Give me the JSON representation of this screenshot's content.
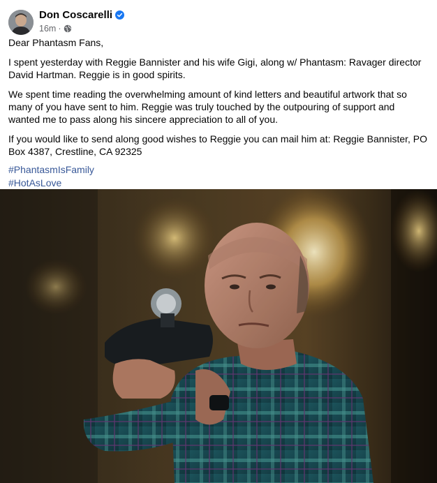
{
  "post": {
    "author": "Don Coscarelli",
    "timestamp": "16m",
    "greeting": "Dear Phantasm Fans,",
    "paragraph1": "I spent yesterday with Reggie Bannister and his wife Gigi, along w/ Phantasm: Ravager director David Hartman. Reggie is in good spirits.",
    "paragraph2": "We spent time reading the overwhelming amount of kind letters and beautiful artwork that so many of you have sent to him. Reggie was truly touched by the outpouring of support and wanted me to pass along his sincere appreciation to all of you.",
    "paragraph3": "If you would like to send along good wishes to Reggie you can mail him at: Reggie Bannister, PO Box 4387, Crestline, CA 92325",
    "hashtags": [
      "#PhantasmIsFamily",
      "#HotAsLove"
    ],
    "separator": "·"
  },
  "icons": {
    "verified": "verified-badge-icon",
    "privacy": "globe-icon"
  },
  "colors": {
    "verified_blue": "#1877f2",
    "hashtag_link": "#385898",
    "meta_gray": "#65676b"
  }
}
